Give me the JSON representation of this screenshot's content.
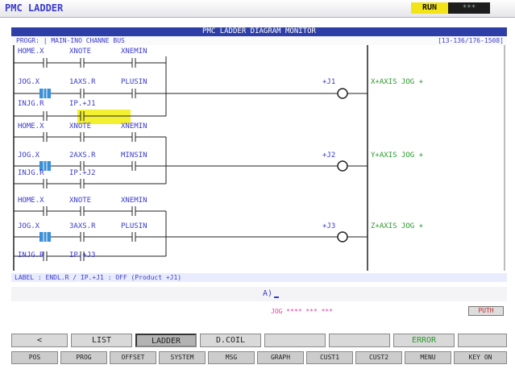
{
  "window": {
    "title": "PMC LADDER",
    "status": "RUN",
    "status_extra": "***"
  },
  "header": {
    "banner": "PMC LADDER DIAGRAM MONITOR",
    "program_line": "PROGR: | MAIN-INO CHANNE BUS",
    "position": "[13-136/176-1508]"
  },
  "rungs": [
    {
      "labels": [
        "HOME.X",
        "XNOTE",
        "XNEMIN"
      ]
    },
    {
      "labels": [
        "JOG.X",
        "1AXS.R",
        "PLUSIN"
      ],
      "coil": "+J1",
      "comment": "X+AXIS JOG +"
    },
    {
      "labels": [
        "INJG.R",
        "IP.+J1"
      ]
    },
    {
      "labels": [
        "HOME.X",
        "XNOTE",
        "XNEMIN"
      ]
    },
    {
      "labels": [
        "JOG.X",
        "2AXS.R",
        "MINSIN"
      ],
      "coil": "+J2",
      "comment": "Y+AXIS JOG +"
    },
    {
      "labels": [
        "INJG.R",
        "IP.+J2"
      ]
    },
    {
      "labels": [
        "HOME.X",
        "XNOTE",
        "XNEMIN"
      ]
    },
    {
      "labels": [
        "JOG.X",
        "3AXS.R",
        "PLUSIN"
      ],
      "coil": "+J3",
      "comment": "Z+AXIS JOG +"
    },
    {
      "labels": [
        "INJG.R",
        "IP.+J3"
      ]
    }
  ],
  "status_line": "LABEL : ENDL.R / IP.+J1 : OFF (Product +J1)",
  "input": {
    "prompt": "A)",
    "value": ""
  },
  "status_extra": {
    "mode": "JOG **** *** ***",
    "right": "PUTH"
  },
  "softkeys": [
    {
      "label": "<"
    },
    {
      "label": "LIST"
    },
    {
      "label": "LADDER",
      "active": true
    },
    {
      "label": "D.COIL"
    },
    {
      "label": ""
    },
    {
      "label": ""
    },
    {
      "label": "ERROR",
      "green": true
    },
    {
      "label": ""
    }
  ],
  "fnkeys": [
    "POS",
    "PROG",
    "OFFSET",
    "SYSTEM",
    "MSG",
    "GRAPH",
    "CUST1",
    "CUST2",
    "MENU",
    "KEY ON"
  ],
  "colors": {
    "ladder_line": "#222222",
    "label": "#3a3acf",
    "comment": "#2a9a2a",
    "highlight": "#f2f030",
    "selected_contact": "#3a8fd8"
  }
}
